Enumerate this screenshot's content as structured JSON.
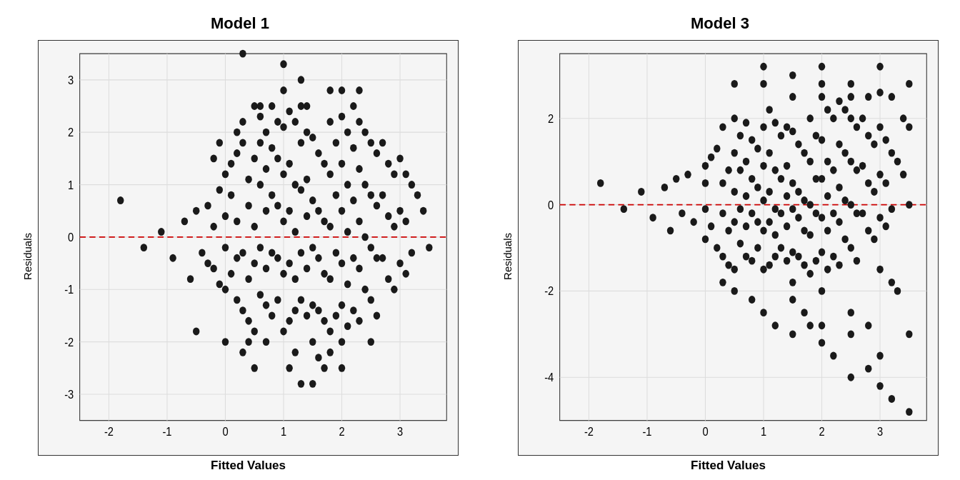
{
  "charts": [
    {
      "id": "model1",
      "title": "Model 1",
      "y_axis_label": "Residuals",
      "x_axis_label": "Fitted Values",
      "x_ticks": [
        "-2",
        "-1",
        "0",
        "1",
        "2",
        "3"
      ],
      "y_ticks": [
        "3",
        "2",
        "1",
        "0",
        "-1",
        "-2",
        "-3"
      ],
      "x_range": [
        -2.5,
        3.8
      ],
      "y_range": [
        -3.5,
        3.5
      ],
      "zero_line_y": 0,
      "points": [
        [
          -1.8,
          0.7
        ],
        [
          -1.4,
          -0.2
        ],
        [
          -1.1,
          0.1
        ],
        [
          -0.9,
          -0.4
        ],
        [
          -0.7,
          0.3
        ],
        [
          -0.6,
          -0.8
        ],
        [
          -0.5,
          0.5
        ],
        [
          -0.4,
          -0.3
        ],
        [
          -0.3,
          0.6
        ],
        [
          -0.3,
          -0.5
        ],
        [
          -0.2,
          0.2
        ],
        [
          -0.2,
          -0.6
        ],
        [
          -0.1,
          0.9
        ],
        [
          -0.1,
          -0.9
        ],
        [
          0.0,
          1.2
        ],
        [
          0.0,
          -0.2
        ],
        [
          0.0,
          0.4
        ],
        [
          0.0,
          -1.0
        ],
        [
          0.1,
          1.4
        ],
        [
          0.1,
          -0.7
        ],
        [
          0.1,
          0.8
        ],
        [
          0.2,
          1.6
        ],
        [
          0.2,
          -1.2
        ],
        [
          0.2,
          0.3
        ],
        [
          0.2,
          -0.4
        ],
        [
          0.3,
          2.2
        ],
        [
          0.3,
          1.8
        ],
        [
          0.3,
          -0.3
        ],
        [
          0.3,
          -1.4
        ],
        [
          0.4,
          1.1
        ],
        [
          0.4,
          0.6
        ],
        [
          0.4,
          -0.8
        ],
        [
          0.4,
          -1.6
        ],
        [
          0.5,
          2.5
        ],
        [
          0.5,
          1.5
        ],
        [
          0.5,
          0.2
        ],
        [
          0.5,
          -0.5
        ],
        [
          0.5,
          -1.8
        ],
        [
          0.6,
          1.8
        ],
        [
          0.6,
          1.0
        ],
        [
          0.6,
          -0.2
        ],
        [
          0.6,
          -1.1
        ],
        [
          0.7,
          2.0
        ],
        [
          0.7,
          1.3
        ],
        [
          0.7,
          0.5
        ],
        [
          0.7,
          -0.6
        ],
        [
          0.7,
          -1.3
        ],
        [
          0.8,
          1.7
        ],
        [
          0.8,
          0.8
        ],
        [
          0.8,
          -0.3
        ],
        [
          0.8,
          -1.5
        ],
        [
          0.9,
          1.5
        ],
        [
          0.9,
          0.6
        ],
        [
          0.9,
          -0.4
        ],
        [
          0.9,
          -1.2
        ],
        [
          1.0,
          3.3
        ],
        [
          1.0,
          2.1
        ],
        [
          1.0,
          1.2
        ],
        [
          1.0,
          0.3
        ],
        [
          1.0,
          -0.7
        ],
        [
          1.0,
          -1.8
        ],
        [
          1.1,
          2.4
        ],
        [
          1.1,
          1.4
        ],
        [
          1.1,
          0.5
        ],
        [
          1.1,
          -0.5
        ],
        [
          1.1,
          -1.6
        ],
        [
          1.2,
          2.2
        ],
        [
          1.2,
          1.0
        ],
        [
          1.2,
          0.1
        ],
        [
          1.2,
          -0.8
        ],
        [
          1.2,
          -1.4
        ],
        [
          1.3,
          1.8
        ],
        [
          1.3,
          0.9
        ],
        [
          1.3,
          -0.3
        ],
        [
          1.3,
          -1.2
        ],
        [
          1.3,
          -2.8
        ],
        [
          1.4,
          2.0
        ],
        [
          1.4,
          1.1
        ],
        [
          1.4,
          0.4
        ],
        [
          1.4,
          -0.6
        ],
        [
          1.4,
          -1.5
        ],
        [
          1.5,
          1.9
        ],
        [
          1.5,
          0.7
        ],
        [
          1.5,
          -0.2
        ],
        [
          1.5,
          -1.3
        ],
        [
          1.5,
          -2.0
        ],
        [
          1.6,
          1.6
        ],
        [
          1.6,
          0.5
        ],
        [
          1.6,
          -0.4
        ],
        [
          1.6,
          -1.4
        ],
        [
          1.7,
          1.4
        ],
        [
          1.7,
          0.3
        ],
        [
          1.7,
          -0.7
        ],
        [
          1.7,
          -1.6
        ],
        [
          1.8,
          2.2
        ],
        [
          1.8,
          1.2
        ],
        [
          1.8,
          0.2
        ],
        [
          1.8,
          -0.8
        ],
        [
          1.8,
          -1.8
        ],
        [
          1.9,
          1.8
        ],
        [
          1.9,
          0.8
        ],
        [
          1.9,
          -0.3
        ],
        [
          1.9,
          -1.5
        ],
        [
          2.0,
          2.3
        ],
        [
          2.0,
          1.4
        ],
        [
          2.0,
          0.5
        ],
        [
          2.0,
          -0.5
        ],
        [
          2.0,
          -1.3
        ],
        [
          2.0,
          -2.5
        ],
        [
          2.1,
          2.0
        ],
        [
          2.1,
          1.0
        ],
        [
          2.1,
          0.1
        ],
        [
          2.1,
          -0.9
        ],
        [
          2.1,
          -1.7
        ],
        [
          2.2,
          1.7
        ],
        [
          2.2,
          0.7
        ],
        [
          2.2,
          -0.4
        ],
        [
          2.2,
          -1.4
        ],
        [
          2.3,
          2.2
        ],
        [
          2.3,
          1.3
        ],
        [
          2.3,
          0.3
        ],
        [
          2.3,
          -0.6
        ],
        [
          2.3,
          -1.6
        ],
        [
          2.4,
          2.0
        ],
        [
          2.4,
          1.0
        ],
        [
          2.4,
          0.0
        ],
        [
          2.4,
          -1.0
        ],
        [
          2.5,
          1.8
        ],
        [
          2.5,
          0.8
        ],
        [
          2.5,
          -0.2
        ],
        [
          2.5,
          -1.2
        ],
        [
          2.6,
          1.6
        ],
        [
          2.6,
          0.6
        ],
        [
          2.6,
          -0.4
        ],
        [
          2.6,
          -1.5
        ],
        [
          2.7,
          1.8
        ],
        [
          2.7,
          0.8
        ],
        [
          2.7,
          -0.4
        ],
        [
          2.8,
          1.4
        ],
        [
          2.8,
          0.4
        ],
        [
          2.8,
          -0.8
        ],
        [
          2.9,
          1.2
        ],
        [
          2.9,
          0.2
        ],
        [
          2.9,
          -1.0
        ],
        [
          3.0,
          1.5
        ],
        [
          3.0,
          0.5
        ],
        [
          3.0,
          -0.5
        ],
        [
          3.1,
          1.2
        ],
        [
          3.1,
          0.3
        ],
        [
          3.1,
          -0.7
        ],
        [
          3.2,
          1.0
        ],
        [
          3.2,
          -0.3
        ],
        [
          3.3,
          0.8
        ],
        [
          3.4,
          0.5
        ],
        [
          3.5,
          -0.2
        ],
        [
          0.0,
          -2.0
        ],
        [
          -0.2,
          1.5
        ],
        [
          0.5,
          -2.5
        ],
        [
          0.3,
          3.5
        ],
        [
          1.3,
          3.0
        ],
        [
          1.5,
          -2.8
        ],
        [
          2.0,
          2.8
        ],
        [
          -0.5,
          -1.8
        ],
        [
          1.8,
          -2.2
        ],
        [
          0.8,
          2.5
        ],
        [
          1.2,
          -2.2
        ],
        [
          0.6,
          2.3
        ],
        [
          -0.1,
          1.8
        ],
        [
          0.4,
          -2.0
        ],
        [
          1.0,
          2.8
        ],
        [
          1.6,
          -2.3
        ],
        [
          2.2,
          2.5
        ],
        [
          2.5,
          -2.0
        ],
        [
          1.8,
          2.8
        ],
        [
          0.2,
          2.0
        ],
        [
          0.7,
          -2.0
        ],
        [
          1.4,
          2.5
        ],
        [
          2.0,
          -2.0
        ],
        [
          1.1,
          -2.5
        ],
        [
          0.9,
          2.2
        ],
        [
          2.3,
          2.8
        ],
        [
          1.7,
          -2.5
        ],
        [
          1.3,
          2.5
        ],
        [
          0.3,
          -2.2
        ],
        [
          0.6,
          2.5
        ]
      ]
    },
    {
      "id": "model3",
      "title": "Model 3",
      "y_axis_label": "Residuals",
      "x_axis_label": "Fitted Values",
      "x_ticks": [
        "-2",
        "-1",
        "0",
        "1",
        "2",
        "3"
      ],
      "y_ticks": [
        "2",
        "0",
        "-2",
        "-4"
      ],
      "x_range": [
        -2.5,
        3.8
      ],
      "y_range": [
        -5.0,
        3.5
      ],
      "zero_line_y": 0,
      "points": [
        [
          -1.8,
          0.5
        ],
        [
          -1.4,
          -0.1
        ],
        [
          -1.1,
          0.3
        ],
        [
          -0.9,
          -0.3
        ],
        [
          -0.7,
          0.4
        ],
        [
          -0.6,
          -0.6
        ],
        [
          -0.5,
          0.6
        ],
        [
          -0.4,
          -0.2
        ],
        [
          -0.3,
          0.7
        ],
        [
          -0.2,
          -0.4
        ],
        [
          0.0,
          0.9
        ],
        [
          0.0,
          -0.1
        ],
        [
          0.0,
          0.5
        ],
        [
          0.0,
          -0.8
        ],
        [
          0.1,
          1.1
        ],
        [
          0.1,
          -0.5
        ],
        [
          0.2,
          1.3
        ],
        [
          0.2,
          -1.0
        ],
        [
          0.3,
          1.8
        ],
        [
          0.3,
          0.5
        ],
        [
          0.3,
          -0.2
        ],
        [
          0.3,
          -1.2
        ],
        [
          0.4,
          0.8
        ],
        [
          0.4,
          -0.6
        ],
        [
          0.4,
          -1.4
        ],
        [
          0.5,
          2.0
        ],
        [
          0.5,
          1.2
        ],
        [
          0.5,
          0.3
        ],
        [
          0.5,
          -0.4
        ],
        [
          0.5,
          -1.5
        ],
        [
          0.6,
          1.6
        ],
        [
          0.6,
          0.8
        ],
        [
          0.6,
          -0.1
        ],
        [
          0.6,
          -0.9
        ],
        [
          0.7,
          1.9
        ],
        [
          0.7,
          1.0
        ],
        [
          0.7,
          0.2
        ],
        [
          0.7,
          -0.5
        ],
        [
          0.7,
          -1.2
        ],
        [
          0.8,
          1.5
        ],
        [
          0.8,
          0.6
        ],
        [
          0.8,
          -0.2
        ],
        [
          0.8,
          -1.3
        ],
        [
          0.9,
          1.3
        ],
        [
          0.9,
          0.4
        ],
        [
          0.9,
          -0.4
        ],
        [
          0.9,
          -1.0
        ],
        [
          1.0,
          2.8
        ],
        [
          1.0,
          1.8
        ],
        [
          1.0,
          0.9
        ],
        [
          1.0,
          0.1
        ],
        [
          1.0,
          -0.6
        ],
        [
          1.0,
          -1.5
        ],
        [
          1.1,
          2.2
        ],
        [
          1.1,
          1.2
        ],
        [
          1.1,
          0.3
        ],
        [
          1.1,
          -0.4
        ],
        [
          1.1,
          -1.4
        ],
        [
          1.2,
          1.9
        ],
        [
          1.2,
          0.8
        ],
        [
          1.2,
          -0.1
        ],
        [
          1.2,
          -0.7
        ],
        [
          1.2,
          -1.2
        ],
        [
          1.3,
          1.6
        ],
        [
          1.3,
          0.6
        ],
        [
          1.3,
          -0.2
        ],
        [
          1.3,
          -1.0
        ],
        [
          1.4,
          1.8
        ],
        [
          1.4,
          0.9
        ],
        [
          1.4,
          0.2
        ],
        [
          1.4,
          -0.5
        ],
        [
          1.4,
          -1.3
        ],
        [
          1.5,
          1.7
        ],
        [
          1.5,
          0.5
        ],
        [
          1.5,
          -0.1
        ],
        [
          1.5,
          -1.1
        ],
        [
          1.5,
          -1.8
        ],
        [
          1.6,
          1.4
        ],
        [
          1.6,
          0.3
        ],
        [
          1.6,
          -0.3
        ],
        [
          1.6,
          -1.2
        ],
        [
          1.7,
          1.2
        ],
        [
          1.7,
          0.1
        ],
        [
          1.7,
          -0.6
        ],
        [
          1.7,
          -1.4
        ],
        [
          1.8,
          2.0
        ],
        [
          1.8,
          1.0
        ],
        [
          1.8,
          0.0
        ],
        [
          1.8,
          -0.7
        ],
        [
          1.8,
          -1.6
        ],
        [
          1.9,
          1.6
        ],
        [
          1.9,
          0.6
        ],
        [
          1.9,
          -0.2
        ],
        [
          1.9,
          -1.3
        ],
        [
          2.0,
          2.5
        ],
        [
          2.0,
          1.5
        ],
        [
          2.0,
          0.6
        ],
        [
          2.0,
          -0.3
        ],
        [
          2.0,
          -1.1
        ],
        [
          2.0,
          -2.0
        ],
        [
          2.1,
          2.2
        ],
        [
          2.1,
          1.0
        ],
        [
          2.1,
          0.2
        ],
        [
          2.1,
          -0.6
        ],
        [
          2.1,
          -1.5
        ],
        [
          2.2,
          2.0
        ],
        [
          2.2,
          0.8
        ],
        [
          2.2,
          -0.2
        ],
        [
          2.2,
          -1.2
        ],
        [
          2.3,
          2.4
        ],
        [
          2.3,
          1.4
        ],
        [
          2.3,
          0.4
        ],
        [
          2.3,
          -0.4
        ],
        [
          2.3,
          -1.4
        ],
        [
          2.4,
          2.2
        ],
        [
          2.4,
          1.2
        ],
        [
          2.4,
          0.1
        ],
        [
          2.4,
          -0.8
        ],
        [
          2.5,
          2.0
        ],
        [
          2.5,
          1.0
        ],
        [
          2.5,
          0.0
        ],
        [
          2.5,
          -1.0
        ],
        [
          2.6,
          1.8
        ],
        [
          2.6,
          0.8
        ],
        [
          2.6,
          -0.2
        ],
        [
          2.6,
          -1.3
        ],
        [
          2.7,
          2.0
        ],
        [
          2.7,
          0.9
        ],
        [
          2.7,
          -0.2
        ],
        [
          2.8,
          1.6
        ],
        [
          2.8,
          0.5
        ],
        [
          2.8,
          -0.6
        ],
        [
          2.9,
          1.4
        ],
        [
          2.9,
          0.3
        ],
        [
          2.9,
          -0.8
        ],
        [
          3.0,
          1.8
        ],
        [
          3.0,
          0.7
        ],
        [
          3.0,
          -0.3
        ],
        [
          3.1,
          1.5
        ],
        [
          3.1,
          0.5
        ],
        [
          3.1,
          -0.5
        ],
        [
          3.2,
          1.2
        ],
        [
          3.2,
          -0.1
        ],
        [
          3.3,
          1.0
        ],
        [
          3.4,
          0.7
        ],
        [
          3.5,
          0.0
        ],
        [
          0.5,
          2.8
        ],
        [
          1.0,
          3.2
        ],
        [
          1.5,
          3.0
        ],
        [
          2.0,
          3.2
        ],
        [
          2.5,
          2.8
        ],
        [
          3.0,
          2.6
        ],
        [
          3.0,
          -1.5
        ],
        [
          3.2,
          -1.8
        ],
        [
          3.3,
          -2.0
        ],
        [
          3.4,
          2.0
        ],
        [
          3.5,
          1.8
        ],
        [
          2.8,
          2.5
        ],
        [
          2.5,
          2.5
        ],
        [
          3.2,
          2.5
        ],
        [
          3.5,
          2.8
        ],
        [
          2.0,
          2.8
        ],
        [
          1.5,
          2.5
        ],
        [
          3.0,
          3.2
        ],
        [
          2.5,
          -2.5
        ],
        [
          2.0,
          -2.8
        ],
        [
          1.5,
          -2.2
        ],
        [
          2.5,
          -3.0
        ],
        [
          3.0,
          -3.5
        ],
        [
          2.8,
          -2.8
        ],
        [
          3.5,
          -3.0
        ],
        [
          3.2,
          -4.5
        ],
        [
          1.8,
          -2.8
        ],
        [
          0.5,
          -2.0
        ],
        [
          1.0,
          -2.5
        ],
        [
          2.0,
          -3.2
        ],
        [
          1.5,
          -3.0
        ],
        [
          2.5,
          -4.0
        ],
        [
          1.2,
          -2.8
        ],
        [
          0.8,
          -2.2
        ],
        [
          0.3,
          -1.8
        ],
        [
          1.7,
          -2.5
        ],
        [
          2.2,
          -3.5
        ],
        [
          2.8,
          -3.8
        ],
        [
          3.0,
          -4.2
        ],
        [
          3.5,
          -4.8
        ]
      ]
    }
  ]
}
